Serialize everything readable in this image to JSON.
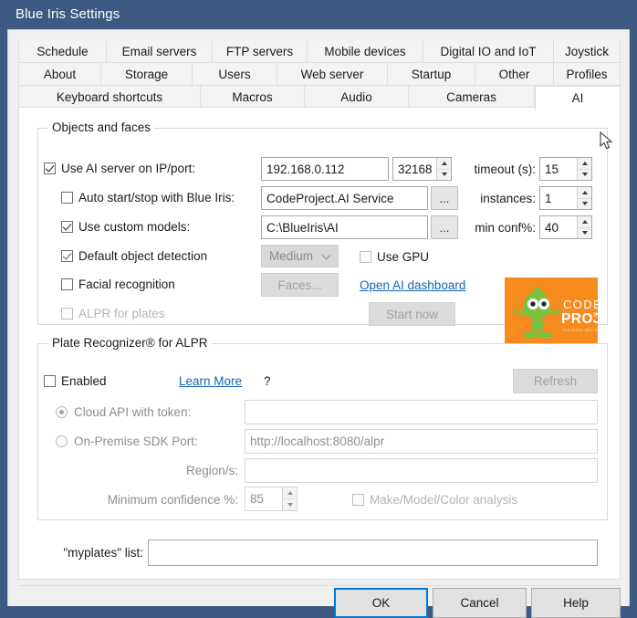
{
  "window": {
    "title": "Blue Iris Settings"
  },
  "tabs": {
    "row1": [
      {
        "label": "Schedule",
        "selected": false
      },
      {
        "label": "Email servers",
        "selected": false
      },
      {
        "label": "FTP servers",
        "selected": false
      },
      {
        "label": "Mobile devices",
        "selected": false
      },
      {
        "label": "Digital IO and IoT",
        "selected": false
      },
      {
        "label": "Joystick",
        "selected": false
      }
    ],
    "row2": [
      {
        "label": "About",
        "selected": false
      },
      {
        "label": "Storage",
        "selected": false
      },
      {
        "label": "Users",
        "selected": false
      },
      {
        "label": "Web server",
        "selected": false
      },
      {
        "label": "Startup",
        "selected": false
      },
      {
        "label": "Other",
        "selected": false
      },
      {
        "label": "Profiles",
        "selected": false
      }
    ],
    "row3": [
      {
        "label": "Keyboard shortcuts",
        "selected": false
      },
      {
        "label": "Macros",
        "selected": false
      },
      {
        "label": "Audio",
        "selected": false
      },
      {
        "label": "Cameras",
        "selected": false
      },
      {
        "label": "AI",
        "selected": true
      }
    ]
  },
  "objects_group": {
    "title": "Objects and faces",
    "use_ai_server": {
      "label": "Use AI server on IP/port:",
      "checked": true
    },
    "ip_value": "192.168.0.112",
    "port_value": "32168",
    "timeout_label": "timeout (s):",
    "timeout_value": "15",
    "auto_start": {
      "label": "Auto start/stop with Blue Iris:",
      "checked": false
    },
    "service_value": "CodeProject.AI Service",
    "browse_service_label": "...",
    "instances_label": "instances:",
    "instances_value": "1",
    "use_custom_models": {
      "label": "Use custom models:",
      "checked": true
    },
    "models_path_value": "C:\\BlueIris\\AI",
    "browse_models_label": "...",
    "min_conf_label": "min conf%:",
    "min_conf_value": "40",
    "default_object_detection": {
      "label": "Default object detection",
      "checked": true
    },
    "detection_size_value": "Medium",
    "use_gpu": {
      "label": "Use GPU",
      "checked": false
    },
    "facial_recognition": {
      "label": "Facial recognition",
      "checked": false
    },
    "faces_button_label": "Faces...",
    "dashboard_link_label": "Open AI dashboard",
    "alpr_for_plates": {
      "label": "ALPR for plates",
      "checked": false
    },
    "start_now_label": "Start now",
    "logo": {
      "line1": "CODE",
      "line2": "PROJECT",
      "tagline": "For those who code",
      "registered": "®",
      "bg": "#f78b1e",
      "text": "#ffffff"
    }
  },
  "plate_group": {
    "title": "Plate Recognizer® for ALPR",
    "enabled": {
      "label": "Enabled",
      "checked": false
    },
    "learn_more_label": "Learn More",
    "help_label": "?",
    "refresh_label": "Refresh",
    "cloud_api": {
      "label": "Cloud API with token:",
      "selected": true
    },
    "cloud_token_value": "",
    "on_premise": {
      "label": "On-Premise SDK Port:",
      "selected": false
    },
    "on_premise_value": "http://localhost:8080/alpr",
    "regions_label": "Region/s:",
    "regions_value": "",
    "min_conf_label": "Minimum confidence %:",
    "min_conf_value": "85",
    "make_model_color": {
      "label": "Make/Model/Color analysis",
      "checked": false
    }
  },
  "myplates": {
    "label": "\"myplates\" list:",
    "value": ""
  },
  "dialog_buttons": {
    "ok": "OK",
    "cancel": "Cancel",
    "help": "Help"
  },
  "colors": {
    "titlebar": "#3c5a82",
    "accent_link": "#1464b4",
    "default_button_border": "#0078d7",
    "logo_orange": "#f78b1e"
  }
}
